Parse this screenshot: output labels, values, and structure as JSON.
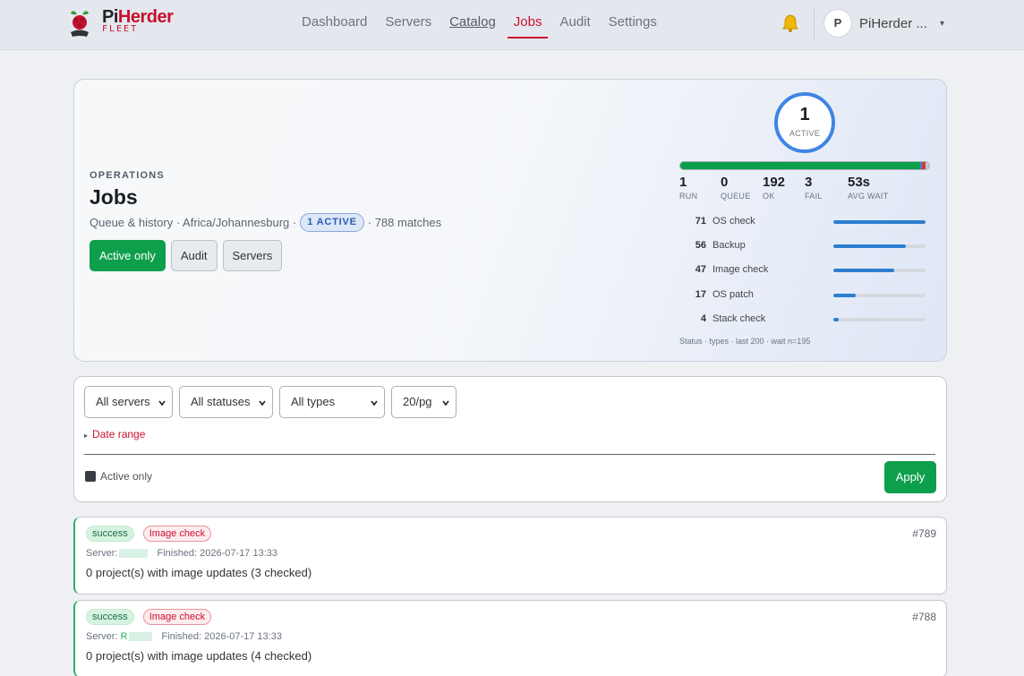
{
  "app": {
    "brand_pi": "Pi",
    "brand_herder": "Herder",
    "brand_sub": "FLEET"
  },
  "nav": {
    "items": [
      {
        "label": "Dashboard",
        "state": "normal"
      },
      {
        "label": "Servers",
        "state": "normal"
      },
      {
        "label": "Catalog",
        "state": "underlined"
      },
      {
        "label": "Jobs",
        "state": "active"
      },
      {
        "label": "Audit",
        "state": "normal"
      },
      {
        "label": "Settings",
        "state": "normal"
      }
    ],
    "notification_icon": "bell-icon",
    "user_initial": "P",
    "user_name": "PiHerder ...",
    "user_caret": "▾"
  },
  "hero": {
    "eyebrow": "OPERATIONS",
    "title": "Jobs",
    "meta_prefix": "Queue & history · Africa/Johannesburg ·",
    "active_pill": "1 ACTIVE",
    "meta_suffix": "· 788 matches",
    "buttons": {
      "active_only": "Active only",
      "audit": "Audit",
      "servers": "Servers"
    },
    "ring_value": "1",
    "ring_label": "ACTIVE",
    "stats": [
      {
        "value": "1",
        "label": "RUN"
      },
      {
        "value": "0",
        "label": "QUEUE"
      },
      {
        "value": "192",
        "label": "OK"
      },
      {
        "value": "3",
        "label": "FAIL"
      },
      {
        "value": "53s",
        "label": "AVG WAIT"
      }
    ],
    "status_distribution": {
      "run": 1,
      "queue": 0,
      "ok": 192,
      "fail": 3
    },
    "job_types": [
      {
        "count": "71",
        "name": "OS check",
        "fraction": 1.0
      },
      {
        "count": "56",
        "name": "Backup",
        "fraction": 0.79
      },
      {
        "count": "47",
        "name": "Image check",
        "fraction": 0.66
      },
      {
        "count": "17",
        "name": "OS patch",
        "fraction": 0.24
      },
      {
        "count": "4",
        "name": "Stack check",
        "fraction": 0.06
      }
    ],
    "footnote": "Status · types · last 200 · wait n=195"
  },
  "filters": {
    "server_select": "All servers",
    "status_select": "All statuses",
    "type_select": "All types",
    "page_size_select": "20/pg",
    "date_range": "Date range",
    "active_only_label": "Active only",
    "apply_label": "Apply"
  },
  "jobs": [
    {
      "status": "success",
      "type": "Image check",
      "id": "#789",
      "server_label": "Server:",
      "server_visible": "",
      "finished": "Finished: 2026-07-17 13:33",
      "message": "0 project(s) with image updates (3 checked)"
    },
    {
      "status": "success",
      "type": "Image check",
      "id": "#788",
      "server_label": "Server:",
      "server_visible": "R",
      "finished": "Finished: 2026-07-17 13:33",
      "message": "0 project(s) with image updates (4 checked)"
    }
  ],
  "colors": {
    "brand_red": "#c8102e",
    "primary_green": "#0d9f4c",
    "ring_blue": "#3f84e6",
    "bar_blue": "#2b7fd0",
    "fail_red": "#d63a3a"
  }
}
